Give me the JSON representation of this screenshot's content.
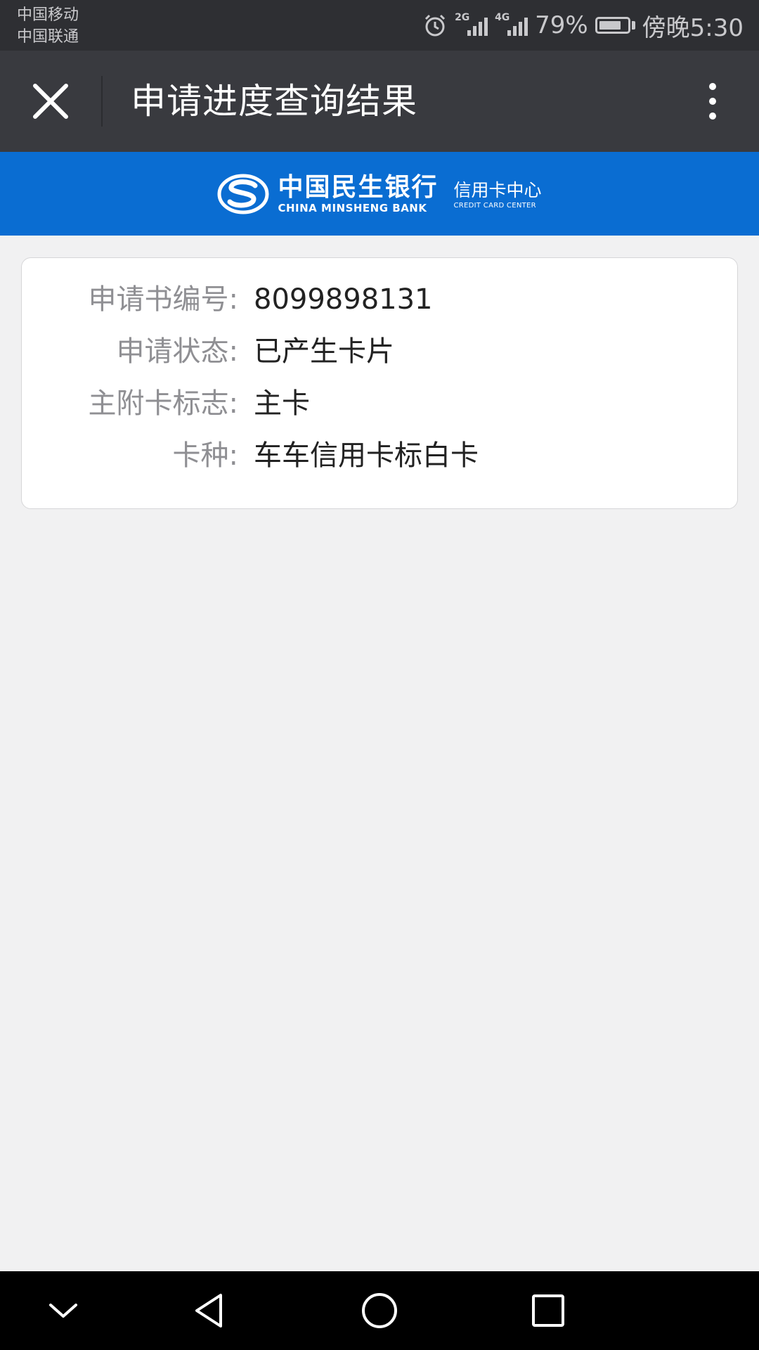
{
  "status_bar": {
    "carrier_1": "中国移动",
    "carrier_2": "中国联通",
    "network_1": "2G",
    "network_2": "4G",
    "battery": "79%",
    "time": "傍晚5:30",
    "battery_level": 0.79
  },
  "title_bar": {
    "title": "申请进度查询结果",
    "close_icon": "close-icon",
    "more_icon": "more-vertical-icon"
  },
  "banner": {
    "bank_cn": "中国民生银行",
    "bank_en": "CHINA MINSHENG BANK",
    "center_cn": "信用卡中心",
    "center_en": "CREDIT CARD CENTER",
    "color": "#0a6dd2"
  },
  "result": {
    "rows": [
      {
        "label": "申请书编号:",
        "value": "8099898131"
      },
      {
        "label": "申请状态:",
        "value": "已产生卡片"
      },
      {
        "label": "主附卡标志:",
        "value": "主卡"
      },
      {
        "label": "卡种:",
        "value": "车车信用卡标白卡"
      }
    ]
  },
  "nav_bar": {
    "icons": [
      "chevron-down-icon",
      "back-icon",
      "home-icon",
      "recents-icon"
    ]
  }
}
